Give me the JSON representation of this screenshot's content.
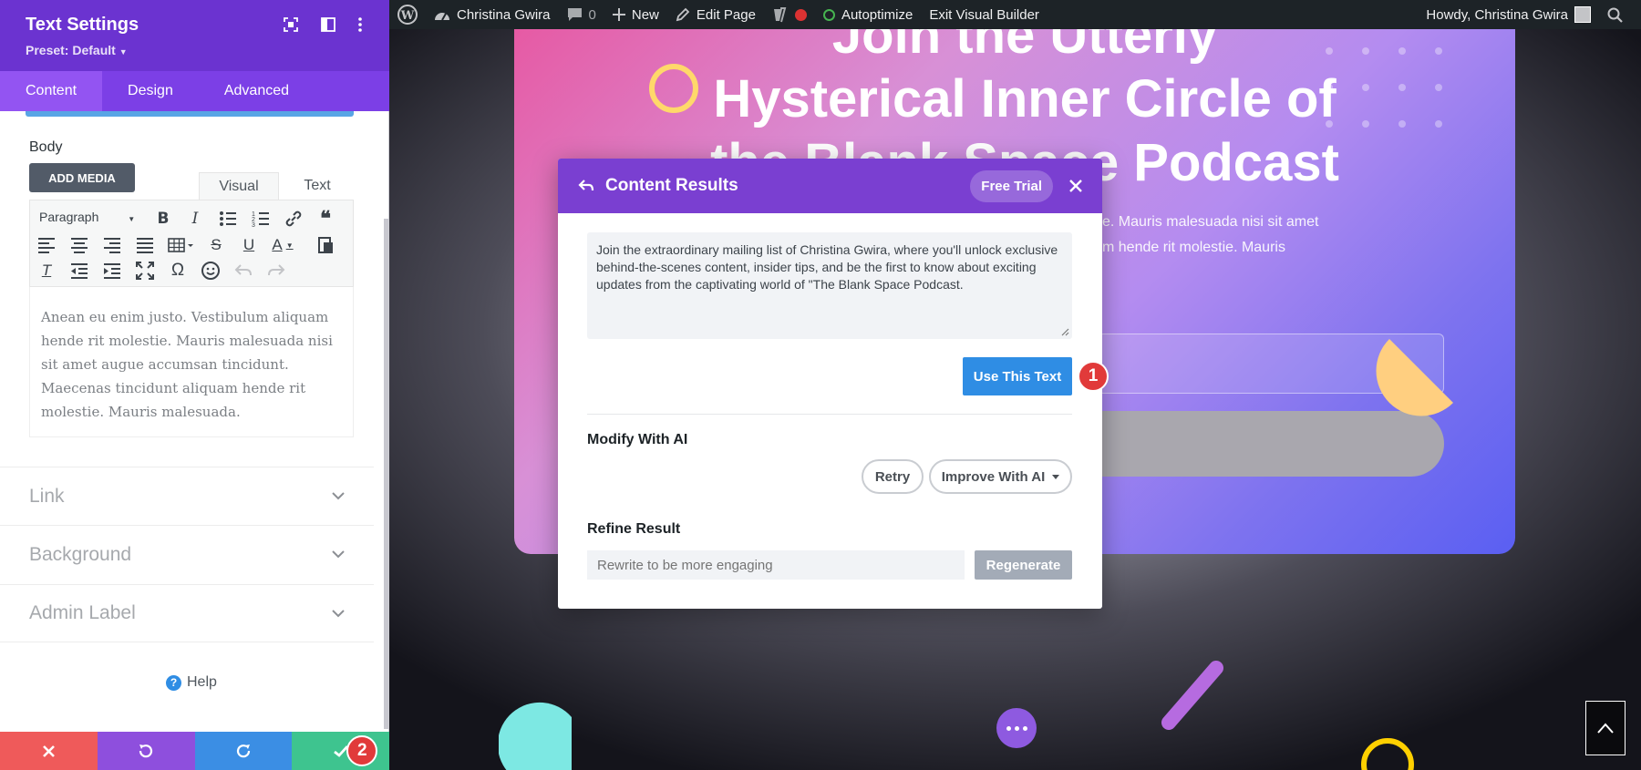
{
  "admin_bar": {
    "site_name": "Christina Gwira",
    "comments_count": "0",
    "new_label": "New",
    "edit_page_label": "Edit Page",
    "autoptimize_label": "Autoptimize",
    "exit_label": "Exit Visual Builder",
    "howdy": "Howdy, Christina Gwira"
  },
  "hero": {
    "heading_lines": [
      "Join the Utterly",
      "Hysterical Inner Circle of",
      "the Blank Space Podcast"
    ],
    "text_lines": [
      "e. Mauris malesuada nisi sit amet",
      "m hende rit molestie. Mauris"
    ]
  },
  "modal": {
    "title": "Content Results",
    "trial_label": "Free Trial",
    "result_text": "Join the extraordinary mailing list of Christina Gwira, where you'll unlock exclusive behind-the-scenes content, insider tips, and be the first to know about exciting updates from the captivating world of \"The Blank Space Podcast.",
    "use_text_label": "Use This Text",
    "badge_1": "1",
    "modify_label": "Modify With AI",
    "retry_label": "Retry",
    "improve_label": "Improve With AI",
    "refine_label": "Refine Result",
    "refine_placeholder": "Rewrite to be more engaging",
    "regenerate_label": "Regenerate"
  },
  "panel": {
    "title": "Text Settings",
    "preset": "Preset: Default",
    "tabs": [
      "Content",
      "Design",
      "Advanced"
    ],
    "body_label": "Body",
    "add_media": "ADD MEDIA",
    "editor_tabs": [
      "Visual",
      "Text"
    ],
    "paragraph_select": "Paragraph",
    "body_text": "Anean eu enim justo. Vestibulum aliquam hende rit molestie. Mauris malesuada nisi sit amet augue accumsan tincidunt. Maecenas tincidunt aliquam hende rit molestie. Mauris malesuada.",
    "sections": [
      "Link",
      "Background",
      "Admin Label"
    ],
    "help_label": "Help",
    "badge_2": "2"
  },
  "colors": {
    "panel_header": "#6b33d0",
    "panel_tabs": "#7c3fe6",
    "modal_header": "#7a3fd1",
    "primary_blue": "#2f8de4",
    "badge_red": "#e13a3a",
    "footer": [
      "#ef5a5a",
      "#8e4fdd",
      "#3b8ee4",
      "#3ec48f"
    ]
  }
}
